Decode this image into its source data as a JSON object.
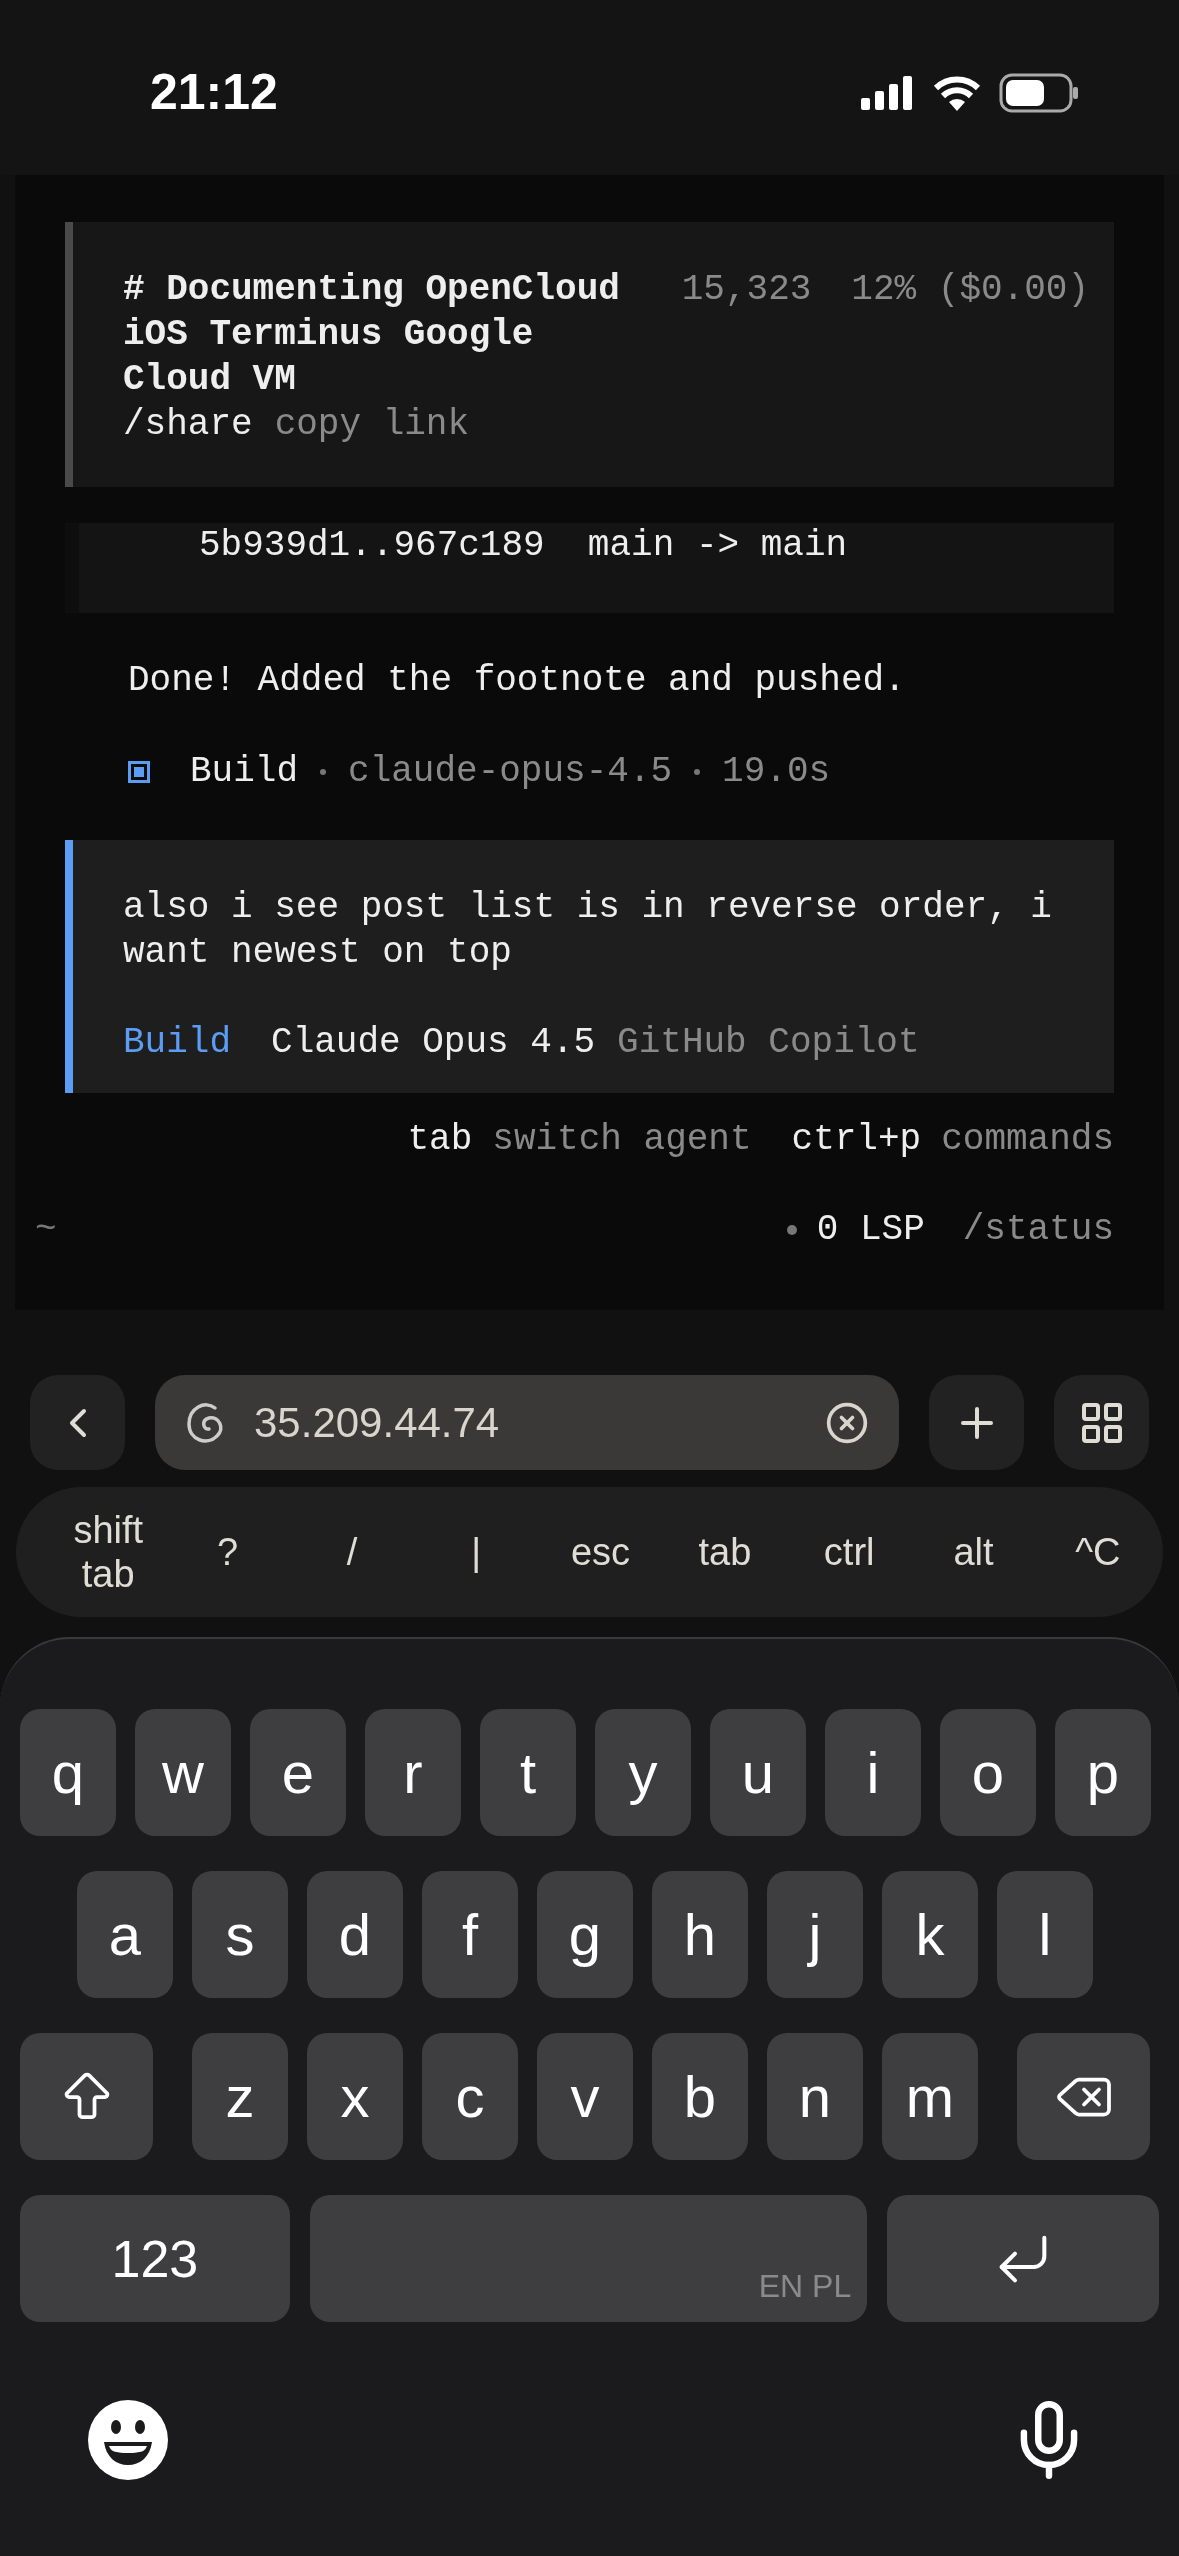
{
  "status_bar": {
    "time": "21:12"
  },
  "terminal": {
    "session": {
      "title": "# Documenting OpenCloud iOS Terminus Google Cloud VM",
      "tokens": "15,323",
      "usage": "12% ($0.00)",
      "command": "/share",
      "command_hint": "copy link"
    },
    "git_output": "5b939d1..967c189  main -> main",
    "message": "Done! Added the footnote and pushed.",
    "build_line": {
      "agent": "Build",
      "model": "claude-opus-4.5",
      "duration": "19.0s"
    },
    "input": {
      "value": "also i see post list is in reverse order, i want newest on top",
      "agent": "Build",
      "model": "Claude Opus 4.5",
      "provider": "GitHub Copilot"
    },
    "hints": [
      {
        "key": "tab",
        "label": "switch agent"
      },
      {
        "key": "ctrl+p",
        "label": "commands"
      }
    ],
    "footer": {
      "cwd": "~",
      "lsp": "0 LSP",
      "status": "/status"
    }
  },
  "browser": {
    "url": "35.209.44.74"
  },
  "shortcuts": [
    "shift tab",
    "?",
    "/",
    "|",
    "esc",
    "tab",
    "ctrl",
    "alt",
    "^C"
  ],
  "keyboard": {
    "rows": [
      [
        "q",
        "w",
        "e",
        "r",
        "t",
        "y",
        "u",
        "i",
        "o",
        "p"
      ],
      [
        "a",
        "s",
        "d",
        "f",
        "g",
        "h",
        "j",
        "k",
        "l"
      ],
      [
        "z",
        "x",
        "c",
        "v",
        "b",
        "n",
        "m"
      ]
    ],
    "numbers_key": "123",
    "languages": "EN PL"
  }
}
